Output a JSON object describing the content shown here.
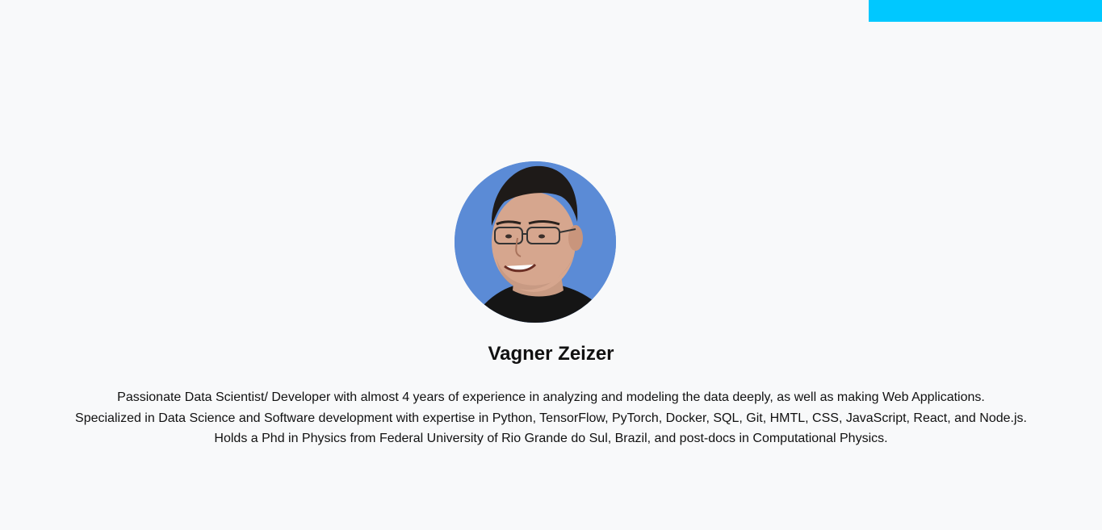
{
  "profile": {
    "name": "Vagner Zeizer",
    "bio_lines": [
      "Passionate Data Scientist/ Developer with almost 4 years of experience in analyzing and modeling the data deeply, as well as making Web Applications.",
      "Specialized in Data Science and Software development with expertise in Python, TensorFlow, PyTorch, Docker, SQL, Git, HMTL, CSS, JavaScript, React, and Node.js.",
      "Holds a Phd in Physics from Federal University of Rio Grande do Sul, Brazil, and post-docs in Computational Physics."
    ],
    "avatar_background": "#5b8bd6"
  },
  "colors": {
    "page_background": "#f8f9fa",
    "accent": "#00c8ff",
    "text": "#111111"
  }
}
